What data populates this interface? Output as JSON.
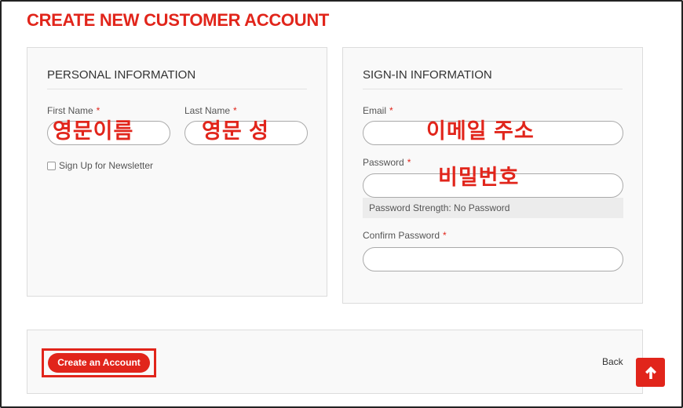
{
  "page": {
    "title": "CREATE NEW CUSTOMER ACCOUNT"
  },
  "personal": {
    "heading": "PERSONAL INFORMATION",
    "first_name": {
      "label": "First Name",
      "required_mark": "*",
      "overlay": "영문이름"
    },
    "last_name": {
      "label": "Last Name",
      "required_mark": "*",
      "overlay": "영문 성"
    },
    "newsletter": {
      "label": "Sign Up for Newsletter",
      "checked": false
    }
  },
  "signin": {
    "heading": "SIGN-IN INFORMATION",
    "email": {
      "label": "Email",
      "required_mark": "*",
      "overlay": "이메일 주소"
    },
    "password": {
      "label": "Password",
      "required_mark": "*",
      "overlay": "비밀번호",
      "strength_text": "Password Strength: No Password"
    },
    "confirm_password": {
      "label": "Confirm Password",
      "required_mark": "*"
    }
  },
  "actions": {
    "create_label": "Create an Account",
    "back_label": "Back"
  },
  "icons": {
    "scroll_top": "arrow-up-icon"
  },
  "colors": {
    "accent": "#e1251b"
  }
}
